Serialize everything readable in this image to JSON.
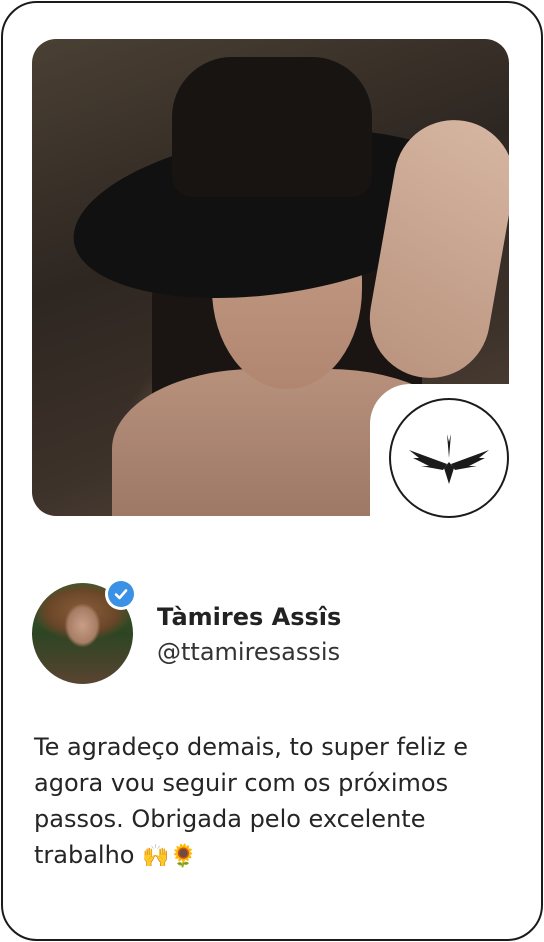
{
  "profile": {
    "name": "Tàmires Assîs",
    "handle": "@ttamiresassis",
    "verified": true
  },
  "testimonial": {
    "text": "Te agradeço demais, to super feliz e agora vou seguir com os próximos passos. Obrigada pelo excelente trabalho",
    "emojis": "🙌🌻"
  },
  "colors": {
    "border": "#1b1b1b",
    "verified_badge": "#3b91e6",
    "text": "#252525"
  },
  "icons": {
    "brand_logo": "winged-arrow-logo-icon",
    "verified": "check-icon"
  }
}
